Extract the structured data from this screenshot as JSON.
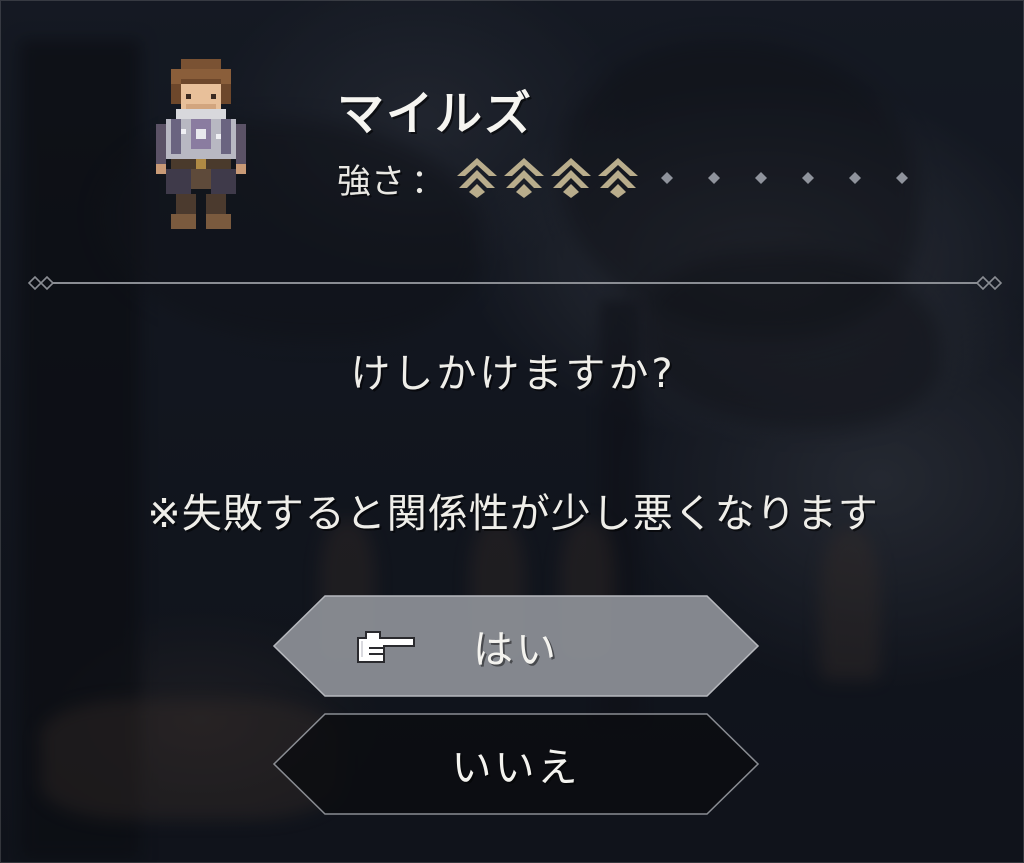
{
  "character": {
    "name": "マイルズ",
    "sprite_icon": "character-sprite-icon"
  },
  "strength": {
    "label": "強さ",
    "separator": "：",
    "level": 4,
    "max": 10,
    "filled_color": "#b9ad8c",
    "empty_color": "#8f939c"
  },
  "dialog": {
    "question": "けしかけますか?",
    "warning": "※失敗すると関係性が少し悪くなります"
  },
  "choices": {
    "yes_label": "はい",
    "no_label": "いいえ",
    "selected": "yes",
    "pointer_icon": "pointing-hand-icon"
  },
  "colors": {
    "selected_button": "#8e9198",
    "unselected_button": "#0c0d10",
    "divider": "#8a8d93"
  }
}
